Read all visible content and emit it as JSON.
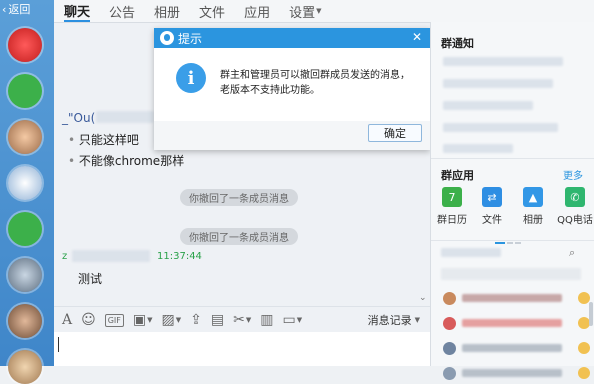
{
  "nav": {
    "back_label": "返回"
  },
  "tabs": [
    {
      "label": "聊天",
      "active": true
    },
    {
      "label": "公告"
    },
    {
      "label": "相册"
    },
    {
      "label": "文件"
    },
    {
      "label": "应用"
    },
    {
      "label": "设置"
    }
  ],
  "chat": {
    "sender1_prefix": "_\"Ou(",
    "lines": [
      "只能这样吧",
      "不能像chrome那样"
    ],
    "recall_notices": [
      "你撤回了一条成员消息",
      "你撤回了一条成员消息"
    ],
    "sender2_prefix": "z",
    "sender2_time": "11:37:44",
    "message2": "测试"
  },
  "dialog": {
    "title": "提示",
    "message": "群主和管理员可以撤回群成员发送的消息，老版本不支持此功能。",
    "ok_label": "确定",
    "close_glyph": "✕"
  },
  "toolbar": {
    "history_label": "消息记录"
  },
  "right_panel": {
    "notice_title": "群通知",
    "apps_title": "群应用",
    "more_label": "更多",
    "apps": [
      {
        "label": "群日历",
        "icon": "calendar-icon",
        "color": "#3cb04a"
      },
      {
        "label": "文件",
        "icon": "file-icon",
        "color": "#2e8ee3"
      },
      {
        "label": "相册",
        "icon": "album-icon",
        "color": "#3297e6"
      },
      {
        "label": "QQ电话",
        "icon": "phone-icon",
        "color": "#2fb66f"
      }
    ]
  },
  "colors": {
    "accent": "#2b95df",
    "strip": "#4a8fd0",
    "time_green": "#2aa14a"
  }
}
